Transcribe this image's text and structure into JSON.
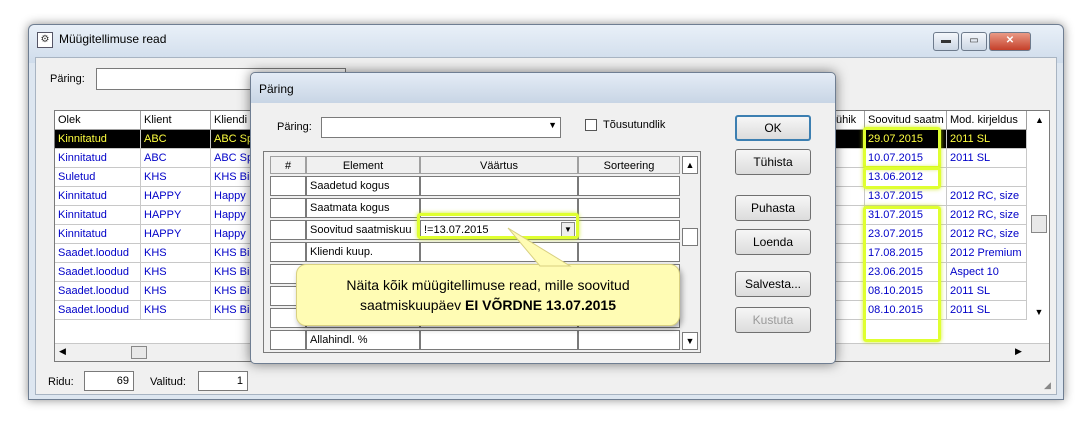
{
  "window": {
    "title": "Müügitellimuse read",
    "min": "▬",
    "max": "▭",
    "close": "✕"
  },
  "query_bar": {
    "label": "Päring:",
    "value": ""
  },
  "grid": {
    "left_headers": [
      "Olek",
      "Klient",
      "Kliendi"
    ],
    "right_headers": [
      "ühik",
      "Soovitud saatm",
      "Mod. kirjeldus"
    ],
    "rows": [
      {
        "olek": "Kinnitatud",
        "klient": "ABC",
        "kliendi": "ABC Sp",
        "soovitud": "29.07.2015",
        "mod": "2011 SL"
      },
      {
        "olek": "Kinnitatud",
        "klient": "ABC",
        "kliendi": "ABC Sp",
        "soovitud": "10.07.2015",
        "mod": "2011 SL"
      },
      {
        "olek": "Suletud",
        "klient": "KHS",
        "kliendi": "KHS Bi",
        "soovitud": "13.06.2012",
        "mod": ""
      },
      {
        "olek": "Kinnitatud",
        "klient": "HAPPY",
        "kliendi": "Happy",
        "soovitud": "13.07.2015",
        "mod": "2012 RC, size"
      },
      {
        "olek": "Kinnitatud",
        "klient": "HAPPY",
        "kliendi": "Happy",
        "soovitud": "31.07.2015",
        "mod": "2012 RC, size"
      },
      {
        "olek": "Kinnitatud",
        "klient": "HAPPY",
        "kliendi": "Happy",
        "soovitud": "23.07.2015",
        "mod": "2012 RC, size"
      },
      {
        "olek": "Saadet.loodud",
        "klient": "KHS",
        "kliendi": "KHS Bi",
        "soovitud": "17.08.2015",
        "mod": "2012 Premium"
      },
      {
        "olek": "Saadet.loodud",
        "klient": "KHS",
        "kliendi": "KHS Bi",
        "soovitud": "23.06.2015",
        "mod": "Aspect 10"
      },
      {
        "olek": "Saadet.loodud",
        "klient": "KHS",
        "kliendi": "KHS Bi",
        "soovitud": "08.10.2015",
        "mod": "2011 SL"
      },
      {
        "olek": "Saadet.loodud",
        "klient": "KHS",
        "kliendi": "KHS Bi",
        "soovitud": "08.10.2015",
        "mod": "2011 SL"
      }
    ]
  },
  "status": {
    "ridu_label": "Ridu:",
    "ridu_value": "69",
    "valitud_label": "Valitud:",
    "valitud_value": "1"
  },
  "dialog": {
    "title": "Päring",
    "paring_label": "Päring:",
    "paring_value": "",
    "checkbox_label": "Tõusutundlik",
    "table_headers": [
      "#",
      "Element",
      "Väärtus",
      "Sorteering"
    ],
    "table_rows": [
      {
        "num": "",
        "element": "Saadetud kogus",
        "value": "",
        "sort": ""
      },
      {
        "num": "",
        "element": "Saatmata kogus",
        "value": "",
        "sort": ""
      },
      {
        "num": "",
        "element": "Soovitud saatmiskuu",
        "value": "!=13.07.2015",
        "sort": ""
      },
      {
        "num": "",
        "element": "Kliendi kuup.",
        "value": "",
        "sort": ""
      },
      {
        "num": "",
        "element": "",
        "value": "",
        "sort": ""
      },
      {
        "num": "",
        "element": "",
        "value": "",
        "sort": ""
      },
      {
        "num": "",
        "element": "",
        "value": "",
        "sort": ""
      },
      {
        "num": "",
        "element": "Allahindl. %",
        "value": "",
        "sort": ""
      }
    ],
    "buttons": {
      "ok": "OK",
      "tuhista": "Tühista",
      "puhasta": "Puhasta",
      "loenda": "Loenda",
      "salvesta": "Salvesta...",
      "kustuta": "Kustuta"
    }
  },
  "callout": {
    "line1": "Näita kõik müügitellimuse read, mille soovitud",
    "line2_prefix": "saatmiskuupäev ",
    "line2_bold": "EI VÕRDNE 13.07.2015"
  },
  "colors": {
    "highlight": "#dfff30",
    "link_blue": "#0000c8",
    "selected_bg": "#000000",
    "selected_fg": "#ffff40",
    "callout_bg": "#fffcb4"
  }
}
